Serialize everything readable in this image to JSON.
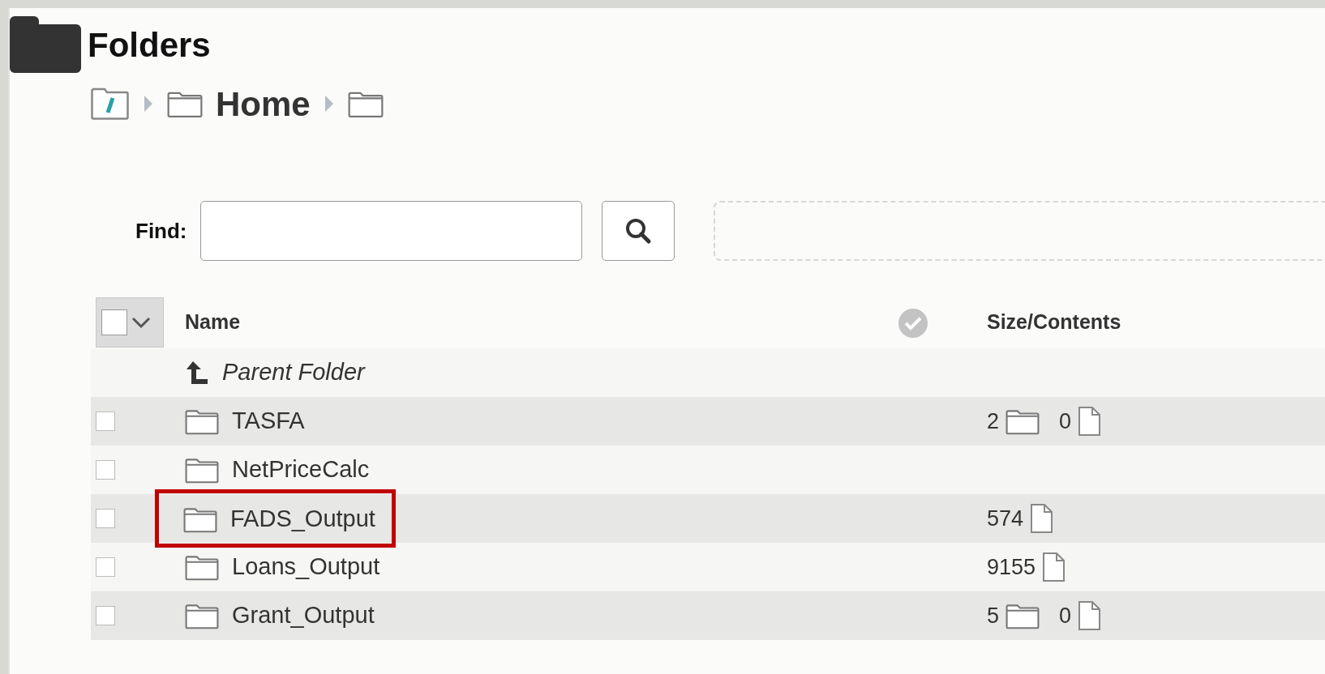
{
  "header": {
    "title": "Folders"
  },
  "breadcrumb": [
    {
      "kind": "root"
    },
    {
      "kind": "folder",
      "label": "Home"
    },
    {
      "kind": "folder"
    }
  ],
  "find": {
    "label": "Find:"
  },
  "table": {
    "columns": [
      "Name",
      "Size/Contents"
    ],
    "rows": [
      {
        "kind": "parent",
        "name": "Parent Folder"
      },
      {
        "kind": "folder",
        "name": "TASFA",
        "checked": false,
        "highlighted": false,
        "contents": [
          {
            "kind": "folder",
            "count": "2"
          },
          {
            "kind": "file",
            "count": "0"
          }
        ]
      },
      {
        "kind": "folder",
        "name": "NetPriceCalc",
        "checked": false,
        "highlighted": false
      },
      {
        "kind": "folder",
        "name": "FADS_Output",
        "checked": false,
        "highlighted": true,
        "contents": [
          {
            "kind": "file",
            "count": "574"
          }
        ]
      },
      {
        "kind": "folder",
        "name": "Loans_Output",
        "checked": false,
        "highlighted": false,
        "contents": [
          {
            "kind": "file",
            "count": "9155"
          }
        ]
      },
      {
        "kind": "folder",
        "name": "Grant_Output",
        "checked": false,
        "highlighted": false,
        "contents": [
          {
            "kind": "folder",
            "count": "5"
          },
          {
            "kind": "file",
            "count": "0"
          }
        ]
      }
    ]
  }
}
